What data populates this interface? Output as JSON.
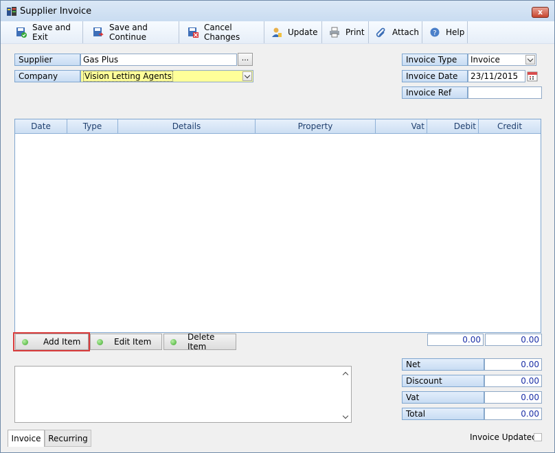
{
  "window": {
    "title": "Supplier Invoice",
    "close_glyph": "x"
  },
  "toolbar": {
    "save_exit": "Save and Exit",
    "save_continue": "Save and Continue",
    "cancel_changes": "Cancel Changes",
    "update": "Update",
    "print": "Print",
    "attach": "Attach",
    "help": "Help"
  },
  "form": {
    "supplier_label": "Supplier",
    "supplier_value": "Gas Plus",
    "supplier_browse": "...",
    "company_label": "Company",
    "company_value": "Vision Letting Agents",
    "invoice_type_label": "Invoice Type",
    "invoice_type_value": "Invoice",
    "invoice_date_label": "Invoice Date",
    "invoice_date_value": "23/11/2015",
    "invoice_ref_label": "Invoice Ref",
    "invoice_ref_value": ""
  },
  "grid": {
    "columns": [
      "Date",
      "Type",
      "Details",
      "Property",
      "Vat",
      "Debit",
      "Credit"
    ],
    "rows": []
  },
  "actions": {
    "add_item": "Add Item",
    "edit_item": "Edit Item",
    "delete_item": "Delete Item"
  },
  "totals": {
    "debit_total": "0.00",
    "credit_total": "0.00",
    "net_label": "Net",
    "net_value": "0.00",
    "discount_label": "Discount",
    "discount_value": "0.00",
    "vat_label": "Vat",
    "vat_value": "0.00",
    "total_label": "Total",
    "total_value": "0.00"
  },
  "tabs": {
    "invoice": "Invoice",
    "recurring": "Recurring"
  },
  "status": {
    "invoice_updated_label": "Invoice Updated",
    "invoice_updated_checked": false
  },
  "colors": {
    "accent_label": "#c8dcf3",
    "highlight_border": "#d93a3a",
    "company_field_bg": "#ffff99",
    "number_text": "#1a2ea6"
  },
  "icons": {
    "title": "app-window-icon",
    "save_exit": "save-check-icon",
    "save_continue": "save-arrow-icon",
    "cancel": "cancel-x-icon",
    "update": "user-update-icon",
    "print": "printer-icon",
    "attach": "paperclip-icon",
    "help": "help-question-icon",
    "calendar": "calendar-icon"
  }
}
